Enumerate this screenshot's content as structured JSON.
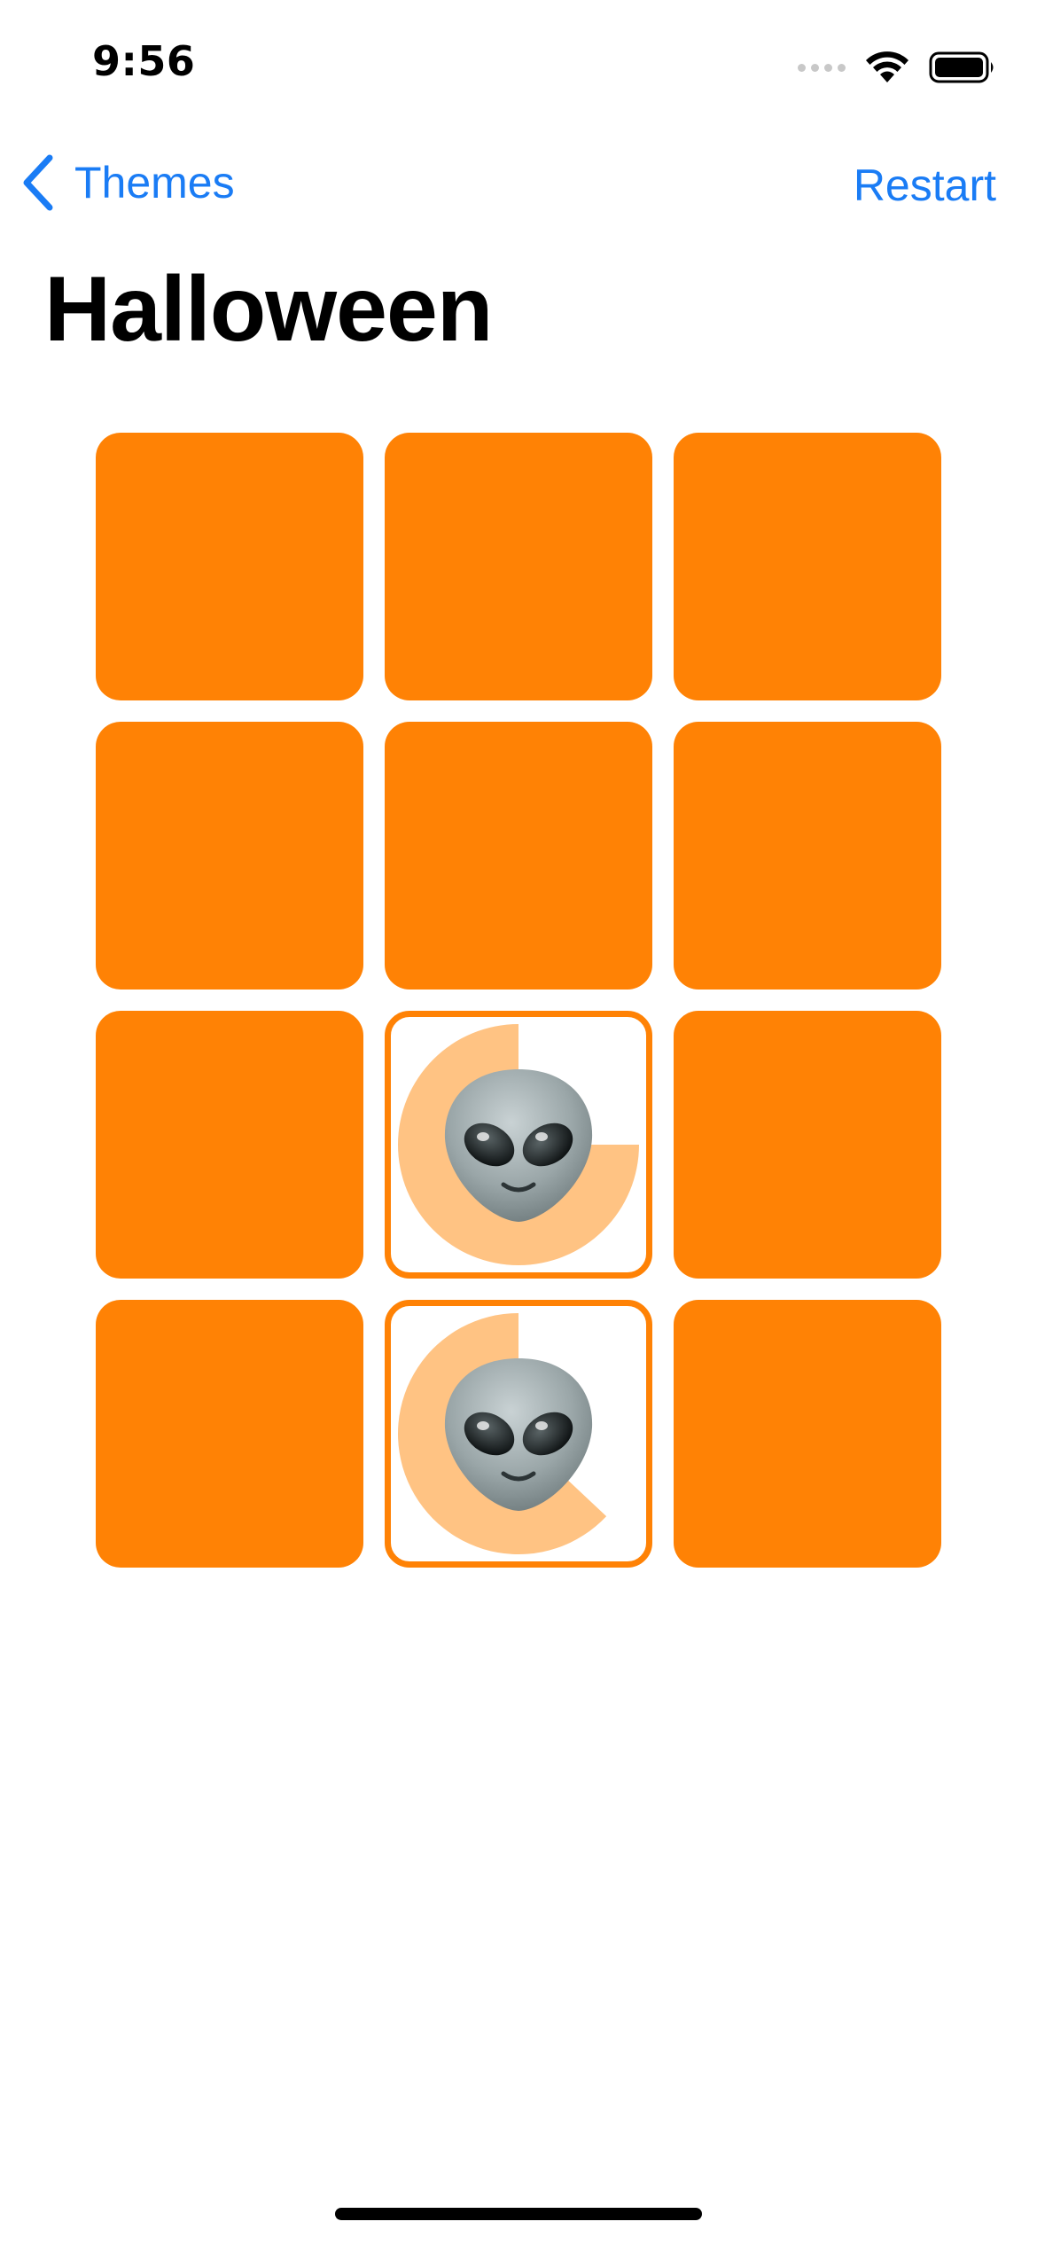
{
  "status_bar": {
    "time": "9:56"
  },
  "nav": {
    "back_label": "Themes",
    "restart_label": "Restart"
  },
  "title": "Halloween",
  "theme": {
    "accent_color": "#ff8205",
    "link_color": "#1a7cf5",
    "pie_color": "#ffc383"
  },
  "cards": [
    {
      "state": "face-down",
      "content": ""
    },
    {
      "state": "face-down",
      "content": ""
    },
    {
      "state": "face-down",
      "content": ""
    },
    {
      "state": "face-down",
      "content": ""
    },
    {
      "state": "face-down",
      "content": ""
    },
    {
      "state": "face-down",
      "content": ""
    },
    {
      "state": "face-down",
      "content": ""
    },
    {
      "state": "face-up",
      "content": "alien-emoji",
      "timer_remaining_fraction": 0.75
    },
    {
      "state": "face-down",
      "content": ""
    },
    {
      "state": "face-down",
      "content": ""
    },
    {
      "state": "face-up",
      "content": "alien-emoji",
      "timer_remaining_fraction": 0.63
    },
    {
      "state": "face-down",
      "content": ""
    }
  ]
}
